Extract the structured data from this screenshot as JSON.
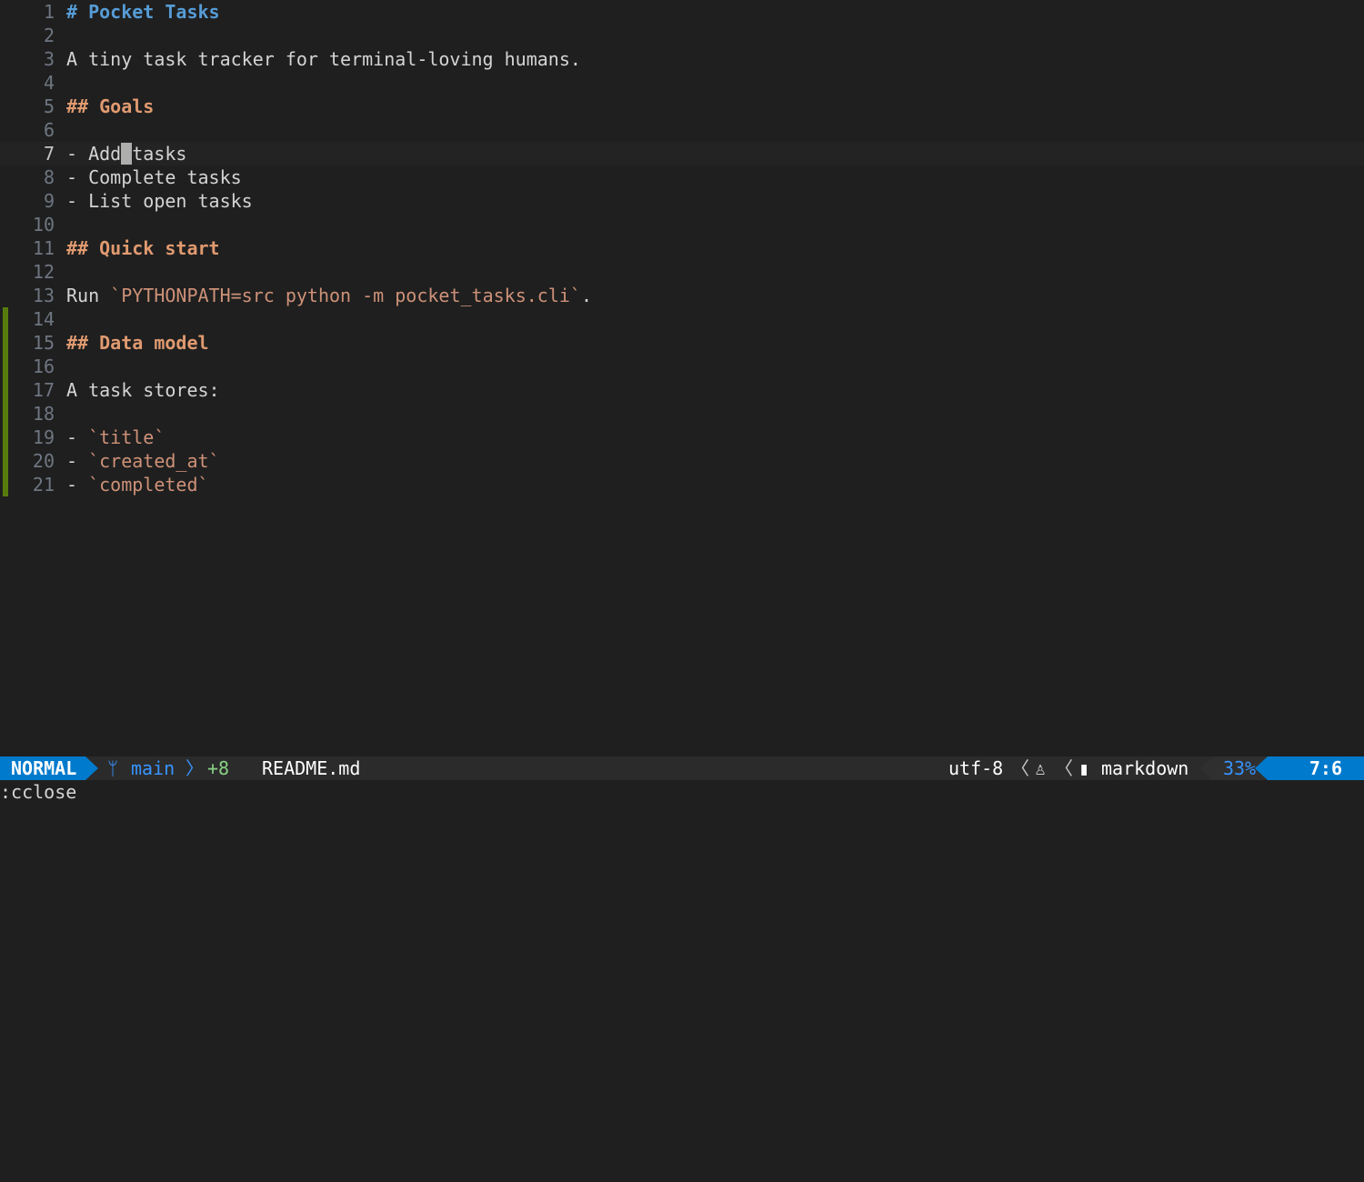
{
  "editor": {
    "lines": [
      {
        "n": "1",
        "parts": [
          {
            "t": "# Pocket Tasks",
            "c": "h1"
          }
        ]
      },
      {
        "n": "2",
        "parts": []
      },
      {
        "n": "3",
        "parts": [
          {
            "t": "A tiny task tracker for terminal-loving humans.",
            "c": ""
          }
        ]
      },
      {
        "n": "4",
        "parts": []
      },
      {
        "n": "5",
        "parts": [
          {
            "t": "## Goals",
            "c": "heading"
          }
        ]
      },
      {
        "n": "6",
        "parts": []
      },
      {
        "n": "7",
        "parts": [
          {
            "t": "- Add",
            "c": ""
          },
          {
            "cursor": true
          },
          {
            "t": "tasks",
            "c": ""
          }
        ],
        "current": true
      },
      {
        "n": "8",
        "parts": [
          {
            "t": "- Complete tasks",
            "c": ""
          }
        ]
      },
      {
        "n": "9",
        "parts": [
          {
            "t": "- List open tasks",
            "c": ""
          }
        ]
      },
      {
        "n": "10",
        "parts": []
      },
      {
        "n": "11",
        "parts": [
          {
            "t": "## Quick start",
            "c": "heading"
          }
        ]
      },
      {
        "n": "12",
        "parts": []
      },
      {
        "n": "13",
        "parts": [
          {
            "t": "Run ",
            "c": ""
          },
          {
            "t": "`PYTHONPATH=src python -m pocket_tasks.cli`",
            "c": "code"
          },
          {
            "t": ".",
            "c": ""
          }
        ]
      },
      {
        "n": "14",
        "parts": [],
        "added": true
      },
      {
        "n": "15",
        "parts": [
          {
            "t": "## Data model",
            "c": "heading"
          }
        ],
        "added": true
      },
      {
        "n": "16",
        "parts": [],
        "added": true
      },
      {
        "n": "17",
        "parts": [
          {
            "t": "A task stores:",
            "c": ""
          }
        ],
        "added": true
      },
      {
        "n": "18",
        "parts": [],
        "added": true
      },
      {
        "n": "19",
        "parts": [
          {
            "t": "- ",
            "c": ""
          },
          {
            "t": "`title`",
            "c": "code"
          }
        ],
        "added": true
      },
      {
        "n": "20",
        "parts": [
          {
            "t": "- ",
            "c": ""
          },
          {
            "t": "`created_at`",
            "c": "code"
          }
        ],
        "added": true
      },
      {
        "n": "21",
        "parts": [
          {
            "t": "- ",
            "c": ""
          },
          {
            "t": "`completed`",
            "c": "code"
          }
        ],
        "added": true
      }
    ]
  },
  "statusline": {
    "mode": "NORMAL",
    "git_icon": "ᛘ",
    "branch": "main",
    "separator": "〉",
    "added_count": "+8",
    "filename": "README.md",
    "encoding": "utf-8",
    "sep_left": "〈",
    "os_icon": "linux-penguin-icon",
    "os_glyph": "♙",
    "filetype_icon_glyph": "▮",
    "filetype": "markdown",
    "percent": "33%",
    "position": "7:6"
  },
  "cmdline": {
    "text": ":cclose"
  },
  "colors": {
    "accent": "#007acc",
    "added": "#587c0c",
    "heading": "#e09a70",
    "h1": "#569cd6",
    "code": "#ce9178"
  }
}
